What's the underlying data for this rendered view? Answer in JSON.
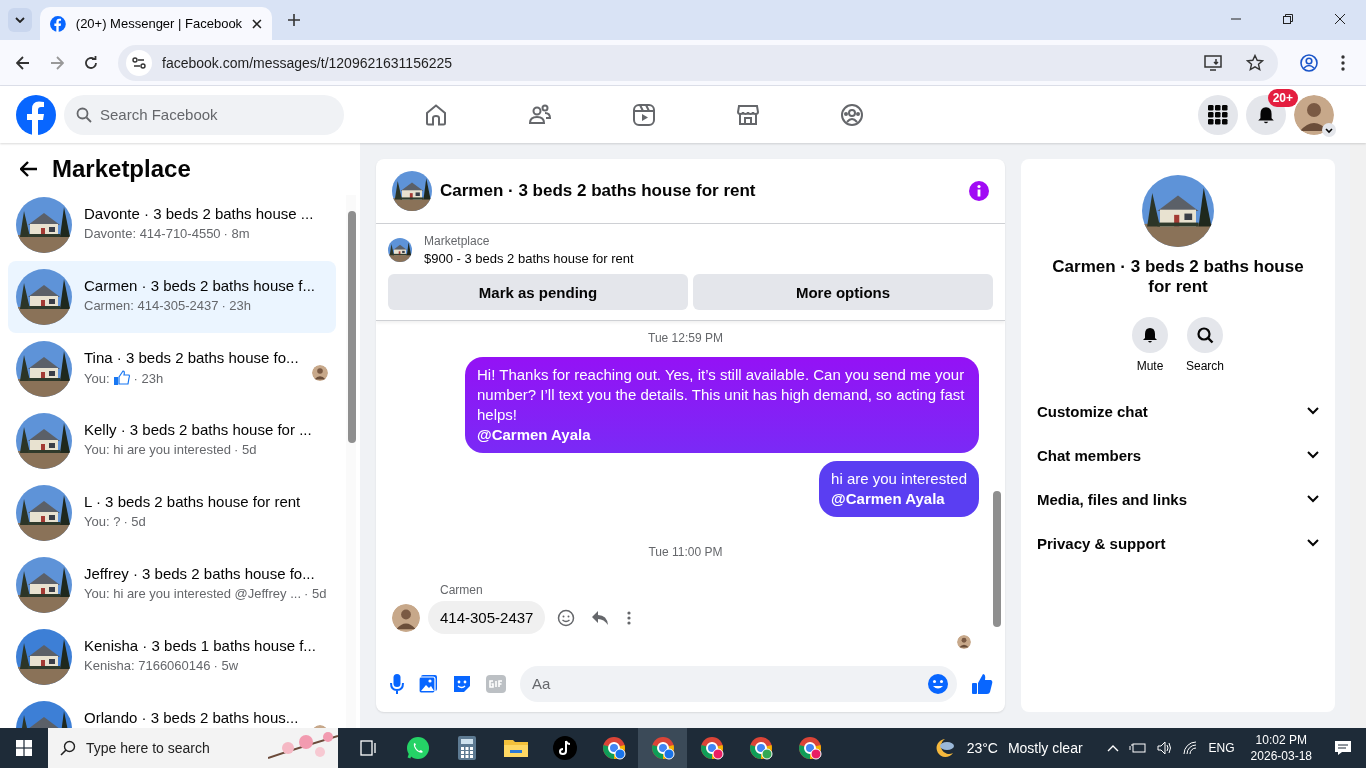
{
  "browser": {
    "tab_title": "(20+) Messenger | Facebook",
    "url": "facebook.com/messages/t/1209621631156225"
  },
  "header": {
    "search": {
      "placeholder": "Search Facebook"
    },
    "notification_badge": "20+"
  },
  "sidebar": {
    "title": "Marketplace",
    "conversations": [
      {
        "title": "Davonte · 3 beds 2 baths house ...",
        "preview": "Davonte: 414-710-4550",
        "time": "· 8m",
        "selected": false,
        "like": false,
        "seen": false
      },
      {
        "title": "Carmen · 3 beds 2 baths house f...",
        "preview": "Carmen: 414-305-2437",
        "time": "· 23h",
        "selected": true,
        "like": false,
        "seen": false
      },
      {
        "title": "Tina · 3 beds 2 baths house fo...",
        "preview": "You:",
        "time": "· 23h",
        "selected": false,
        "like": true,
        "seen": true
      },
      {
        "title": "Kelly · 3 beds 2 baths house for ...",
        "preview": "You: hi are you interested",
        "time": "· 5d",
        "selected": false,
        "like": false,
        "seen": false
      },
      {
        "title": "L · 3 beds 2 baths house for rent",
        "preview": "You: ?",
        "time": "· 5d",
        "selected": false,
        "like": false,
        "seen": false
      },
      {
        "title": "Jeffrey · 3 beds 2 baths house fo...",
        "preview": "You: hi are you interested @Jeffrey ...",
        "time": "· 5d",
        "selected": false,
        "like": false,
        "seen": false
      },
      {
        "title": "Kenisha · 3 beds 1 baths house f...",
        "preview": "Kenisha: 7166060146",
        "time": "· 5w",
        "selected": false,
        "like": false,
        "seen": false
      },
      {
        "title": "Orlando · 3 beds 2 baths hous...",
        "selected": false,
        "like": false,
        "seen": true
      }
    ]
  },
  "chat": {
    "title": "Carmen · 3 beds 2 baths house for rent",
    "listing": {
      "label": "Marketplace",
      "title": "$900 - 3 beds 2 baths house for rent"
    },
    "buttons": [
      "Mark as pending",
      "More options"
    ],
    "messages": [
      {
        "kind": "timestamp",
        "text": "Tue 12:59 PM"
      },
      {
        "kind": "outgoing",
        "text": "Hi! Thanks for reaching out. Yes, it’s still available. Can you send me your number? I’ll text you the details. This unit has high demand, so acting fast helps!\n**@Carmen Ayala**"
      },
      {
        "kind": "outgoing",
        "text": "hi are you interested\n**@Carmen Ayala**"
      },
      {
        "kind": "timestamp",
        "text": "Tue 11:00 PM"
      },
      {
        "kind": "incoming",
        "sender": "Carmen",
        "text": "414-305-2437"
      }
    ],
    "composer": {
      "placeholder": "Aa"
    }
  },
  "details": {
    "title": "Carmen · 3 beds 2 baths house for rent",
    "actions": [
      {
        "kind": "mute",
        "label": "Mute"
      },
      {
        "kind": "search",
        "label": "Search"
      }
    ],
    "sections": [
      "Customize chat",
      "Chat members",
      "Media, files and links",
      "Privacy & support"
    ]
  },
  "taskbar": {
    "search": {
      "placeholder": "Type here to search"
    },
    "temperature": "23°C",
    "weather": "Mostly clear",
    "language": "ENG",
    "time": "10:02 PM",
    "date": "2026-03-18"
  }
}
